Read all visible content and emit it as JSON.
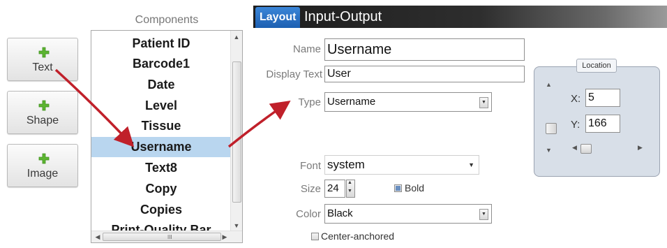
{
  "buttons": [
    {
      "label": "Text"
    },
    {
      "label": "Shape"
    },
    {
      "label": "Image"
    }
  ],
  "components": {
    "title": "Components",
    "items": [
      "Patient ID",
      "Barcode1",
      "Date",
      "Level",
      "Tissue",
      "Username",
      "Text8",
      "Copy",
      "Copies",
      "Print-Quality Bar"
    ],
    "selected_index": 5,
    "hscroll_grip": "III"
  },
  "tabs": {
    "layout": "Layout",
    "input_output": "Input-Output"
  },
  "form": {
    "name_label": "Name",
    "name_value": "Username",
    "display_text_label": "Display Text",
    "display_text_value": "User",
    "type_label": "Type",
    "type_value": "Username",
    "font_label": "Font",
    "font_value": "system",
    "size_label": "Size",
    "size_value": "24",
    "bold_label": "Bold",
    "bold_checked": true,
    "color_label": "Color",
    "color_value": "Black",
    "center_anchored_label": "Center-anchored",
    "center_anchored_checked": false
  },
  "location": {
    "title": "Location",
    "x_label": "X:",
    "x_value": "5",
    "y_label": "Y:",
    "y_value": "166"
  },
  "colors": {
    "selection": "#b9d6ef",
    "tab_active": "#2a73c9",
    "arrow": "#c0202a",
    "plus": "#5cb531"
  },
  "icons": [
    "plus-icon",
    "dropdown-arrow-icon",
    "scroll-arrow-icon",
    "annotation-arrow"
  ]
}
